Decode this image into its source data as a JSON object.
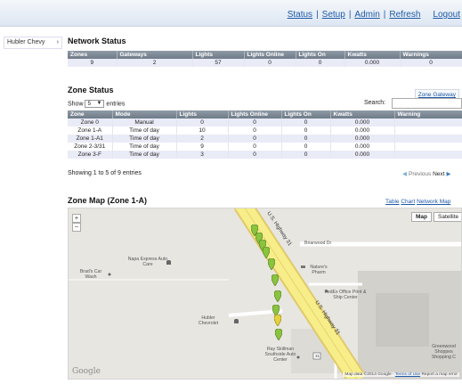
{
  "nav": {
    "status": "Status",
    "setup": "Setup",
    "admin": "Admin",
    "refresh": "Refresh",
    "logout": "Logout"
  },
  "sidebar": {
    "site": "Hubler Chevy"
  },
  "network": {
    "title": "Network Status",
    "headers": [
      "Zones",
      "Gateways",
      "Lights",
      "Lights Online",
      "Lights On",
      "Kwatts",
      "Warnings"
    ],
    "row": [
      "9",
      "2",
      "57",
      "0",
      "0",
      "0.000",
      "0"
    ]
  },
  "zones": {
    "title": "Zone Status",
    "gateway_link": "Zone Gateway",
    "show_label": "Show",
    "show_value": "5",
    "entries_label": "entries",
    "search_label": "Search:",
    "search_value": "",
    "headers": [
      "Zone",
      "Mode",
      "Lights",
      "Lights Online",
      "Lights On",
      "Kwatts",
      "Warning"
    ],
    "rows": [
      [
        "Zone 0",
        "Manual",
        "0",
        "0",
        "0",
        "0.000",
        ""
      ],
      [
        "Zone 1-A",
        "Time of day",
        "10",
        "0",
        "0",
        "0.000",
        ""
      ],
      [
        "Zone 1-A1",
        "Time of day",
        "2",
        "0",
        "0",
        "0.000",
        ""
      ],
      [
        "Zone 2-3/31",
        "Time of day",
        "9",
        "0",
        "0",
        "0.000",
        ""
      ],
      [
        "Zone 3-F",
        "Time of day",
        "3",
        "0",
        "0",
        "0.000",
        ""
      ]
    ],
    "info": "Showing 1 to 5 of 9 entries",
    "previous": "Previous",
    "next": "Next"
  },
  "map": {
    "title": "Zone Map (Zone 1-A)",
    "view_links": {
      "table": "Table",
      "chart": "Chart",
      "network_map": "Network Map"
    },
    "type_map": "Map",
    "type_satellite": "Satellite",
    "zoom_in": "+",
    "zoom_out": "−",
    "labels": {
      "highway_top": "U.S. Highway 31",
      "highway_bottom": "U.S. Highway 31",
      "briarwood": "Briarwood Dr",
      "napa": "Napa Express Auto Care",
      "brads": "Brad's Car Wash",
      "natures": "Nature's Pharm",
      "fedex": "FedEx Office Print & Ship Center",
      "hubler": "Hubler Chevrolet",
      "ray": "Ray Skillman Southside Auto Center",
      "greenwood": "Greenwood Shoppes Shopping C",
      "route_shield": "31"
    },
    "google": "Google",
    "footer_data": "Map data ©2014 Google",
    "footer_terms": "Terms of Use",
    "footer_report": "Report a map error"
  },
  "colors": {
    "link": "#1f5aa8",
    "header_bg": "#7a8592",
    "odd_row": "#e9ebf7",
    "highway": "#f7ee8a",
    "marker": "#8ac43f"
  }
}
